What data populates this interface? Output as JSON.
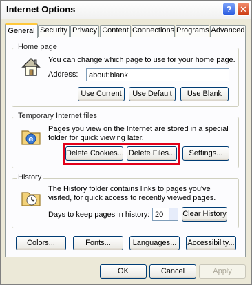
{
  "window": {
    "title": "Internet Options",
    "help_glyph": "?",
    "close_glyph": "✕"
  },
  "tabs": [
    {
      "label": "General",
      "active": true
    },
    {
      "label": "Security"
    },
    {
      "label": "Privacy"
    },
    {
      "label": "Content"
    },
    {
      "label": "Connections"
    },
    {
      "label": "Programs"
    },
    {
      "label": "Advanced"
    }
  ],
  "home_page": {
    "legend": "Home page",
    "description": "You can change which page to use for your home page.",
    "address_label": "Address:",
    "address_value": "about:blank",
    "buttons": [
      "Use Current",
      "Use Default",
      "Use Blank"
    ]
  },
  "temp_files": {
    "legend": "Temporary Internet files",
    "description": "Pages you view on the Internet are stored in a special folder for quick viewing later.",
    "buttons": [
      "Delete Cookies...",
      "Delete Files...",
      "Settings..."
    ]
  },
  "history": {
    "legend": "History",
    "description": "The History folder contains links to pages you've visited, for quick access to recently viewed pages.",
    "days_label": "Days to keep pages in history:",
    "days_value": "20",
    "clear_button": "Clear History"
  },
  "bottom_buttons": [
    "Colors...",
    "Fonts...",
    "Languages...",
    "Accessibility..."
  ],
  "dialog_buttons": [
    "OK",
    "Cancel",
    "Apply"
  ],
  "colors": {
    "highlight": "#e2001a",
    "tab_accent": "#ffc83c"
  },
  "icons": {
    "home_page": "house-icon",
    "temp_files": "folder-ie-icon",
    "history": "history-folder-icon"
  }
}
